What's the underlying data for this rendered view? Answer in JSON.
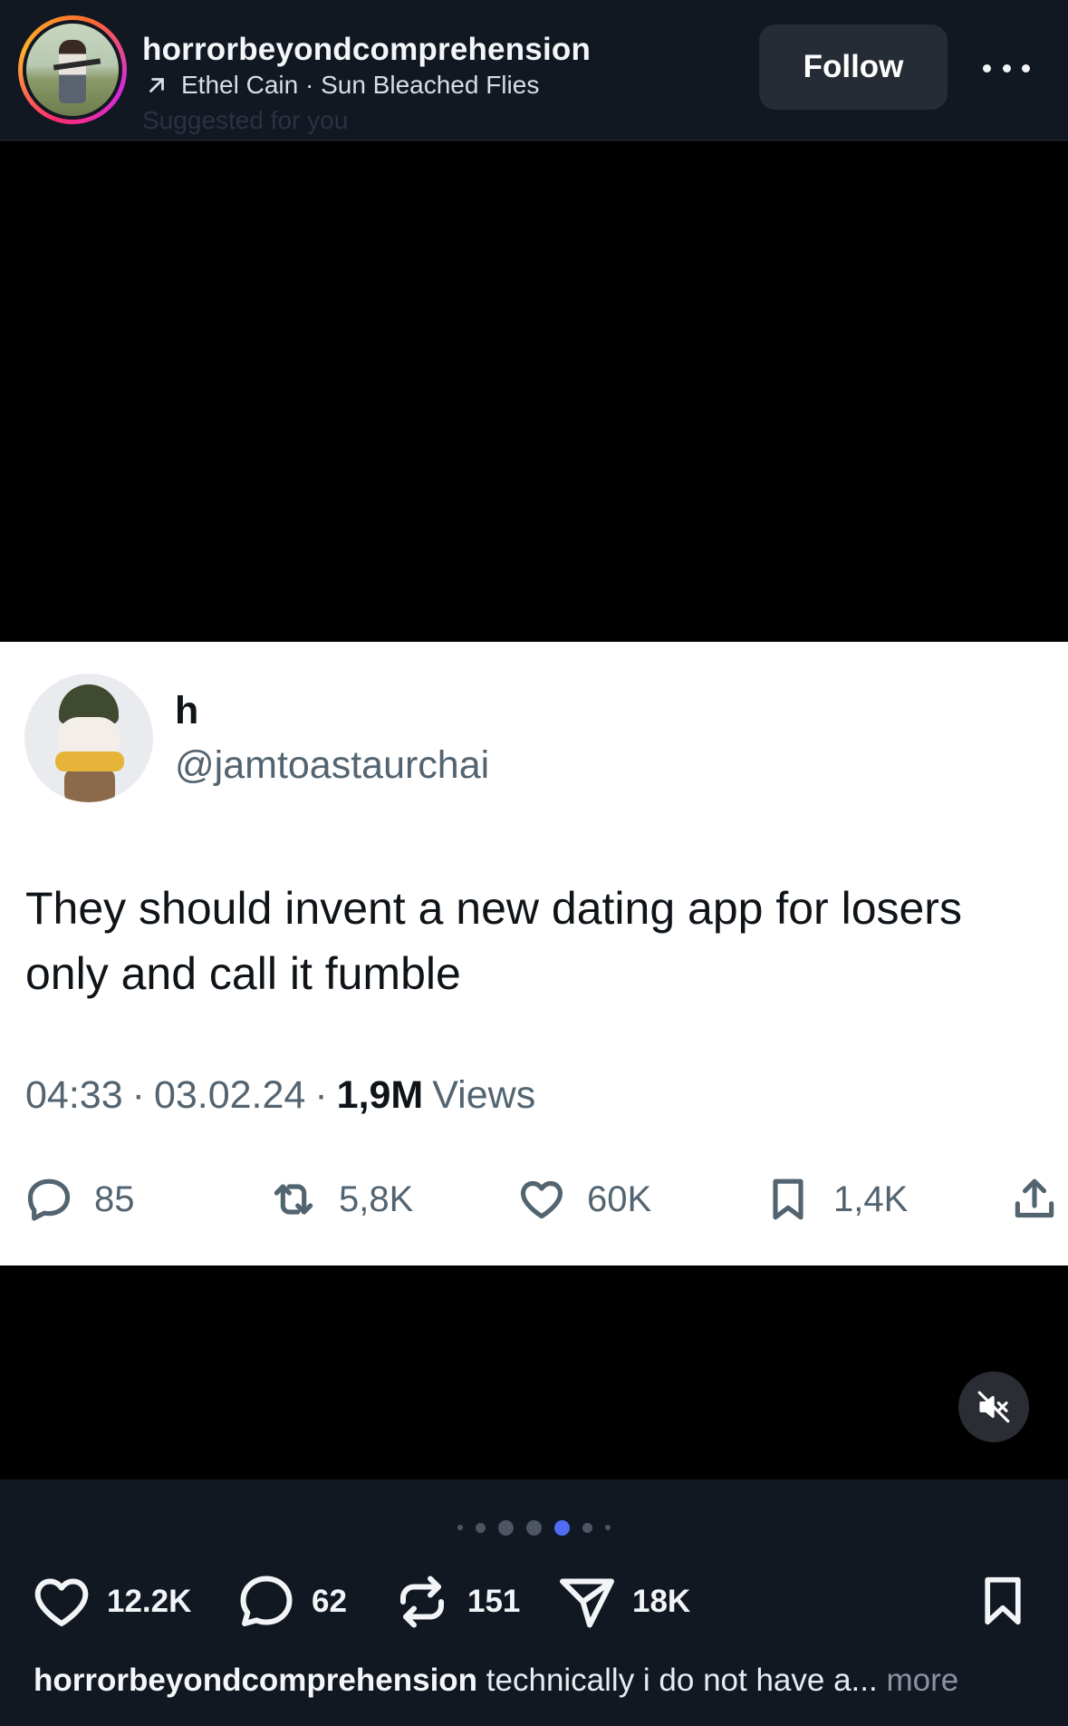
{
  "header": {
    "username": "horrorbeyondcomprehension",
    "music": "Ethel Cain · Sun Bleached Flies",
    "suggested": "Suggested for you",
    "follow_label": "Follow"
  },
  "tweet": {
    "display_name": "h",
    "handle": "@jamtoastaurchai",
    "text": "They should invent a new dating app for losers only and call it fumble",
    "time": "04:33",
    "date": "03.02.24",
    "views_count": "1,9M",
    "views_label": "Views",
    "replies": "85",
    "retweets": "5,8K",
    "likes": "60K",
    "bookmarks": "1,4K"
  },
  "carousel": {
    "total": 7,
    "active_index": 4
  },
  "actions": {
    "likes": "12.2K",
    "comments": "62",
    "reposts": "151",
    "shares": "18K"
  },
  "caption": {
    "username": "horrorbeyondcomprehension",
    "text": " technically i do not have a...",
    "more_label": " more"
  },
  "icons": [
    "arrow-up-right-icon",
    "more-icon",
    "muted-speaker-icon",
    "heart-icon",
    "comment-icon",
    "repost-icon",
    "send-icon",
    "bookmark-icon",
    "share-icon"
  ],
  "colors": {
    "background": "#121822",
    "media_background": "#000000",
    "follow_button": "#262c35",
    "active_dot": "#4f6cf5",
    "tweet_secondary": "#536471"
  }
}
